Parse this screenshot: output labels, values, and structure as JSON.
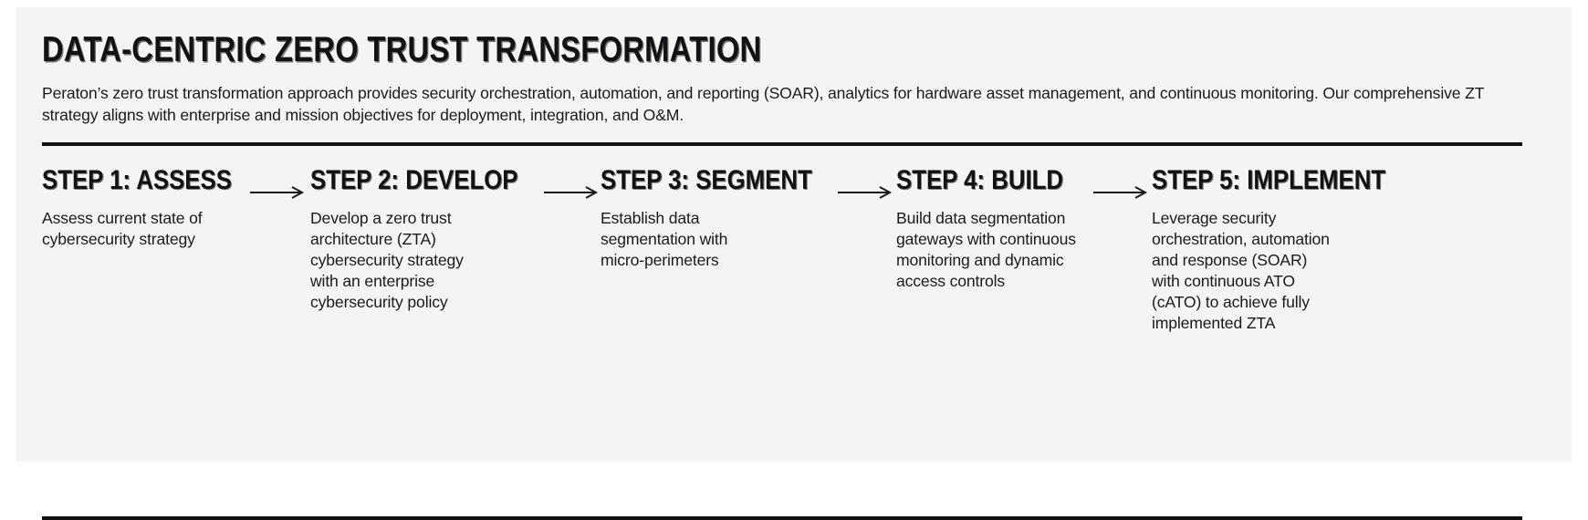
{
  "title": "DATA-CENTRIC ZERO TRUST TRANSFORMATION",
  "intro": "Peraton’s zero trust transformation approach provides security orchestration, automation, and reporting (SOAR), analytics for hardware asset management, and continuous monitoring. Our comprehensive ZT strategy aligns with enterprise and mission objectives for deployment, integration, and O&M.",
  "colors": {
    "background": "#f4f4f3",
    "rule": "#111111",
    "text": "#1a1a1a",
    "heading": "#121212"
  },
  "arrow_label": "arrow-right",
  "steps": [
    {
      "heading": "STEP 1: ASSESS",
      "body": "Assess current state of cybersecurity strategy"
    },
    {
      "heading": "STEP 2: DEVELOP",
      "body": "Develop a zero trust architecture (ZTA) cybersecurity strategy with an enterprise cybersecurity policy"
    },
    {
      "heading": "STEP 3: SEGMENT",
      "body": "Establish data segmentation with micro-perimeters"
    },
    {
      "heading": "STEP 4: BUILD",
      "body": "Build data segmentation gateways with continuous monitoring and dynamic access controls"
    },
    {
      "heading": "STEP 5: IMPLEMENT",
      "body": "Leverage security orchestration, automation and response (SOAR) with continuous ATO (cATO) to achieve fully implemented ZTA"
    }
  ]
}
